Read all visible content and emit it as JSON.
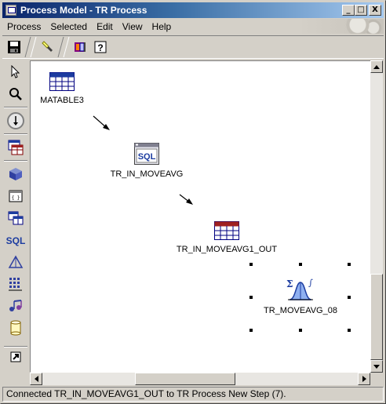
{
  "window": {
    "title": "Process Model - TR Process"
  },
  "title_buttons": {
    "minimize": "_",
    "maximize": "□",
    "close": "X"
  },
  "menu": [
    "Process",
    "Selected",
    "Edit",
    "View",
    "Help"
  ],
  "toolbar": {
    "save": {
      "icon": "save-icon"
    },
    "highlighter": {
      "icon": "highlighter-icon"
    },
    "book": {
      "icon": "book-icon"
    },
    "help": {
      "icon": "help-icon",
      "glyph": "?"
    }
  },
  "palette": [
    {
      "icon": "pointer-icon"
    },
    {
      "icon": "zoom-icon"
    },
    {
      "icon": "connector-icon"
    },
    {
      "icon": "source-table-icon"
    },
    {
      "icon": "cube-icon"
    },
    {
      "icon": "program-icon"
    },
    {
      "icon": "tables-icon"
    },
    {
      "icon": "sql-icon",
      "text": "SQL"
    },
    {
      "icon": "triangle-icon"
    },
    {
      "icon": "grid-icon"
    },
    {
      "icon": "music-icon"
    },
    {
      "icon": "cylinder-icon"
    }
  ],
  "canvas": {
    "nodes": [
      {
        "name": "MATABLE3",
        "icon": "table-icon"
      },
      {
        "name": "TR_IN_MOVEAVG",
        "icon": "sql-step-icon",
        "icon_text": "SQL"
      },
      {
        "name": "TR_IN_MOVEAVG1_OUT",
        "icon": "target-table-icon"
      },
      {
        "name": "TR_MOVEAVG_08",
        "icon": "statistics-icon",
        "selected": true
      }
    ]
  },
  "status": {
    "text": "Connected TR_IN_MOVEAVG1_OUT to TR Process New Step (7)."
  },
  "colors": {
    "title_start": "#0a246a",
    "title_end": "#a6caf0",
    "face": "#d4d0c8",
    "table_header": "#1c3ca0",
    "output_header": "#a02020"
  }
}
